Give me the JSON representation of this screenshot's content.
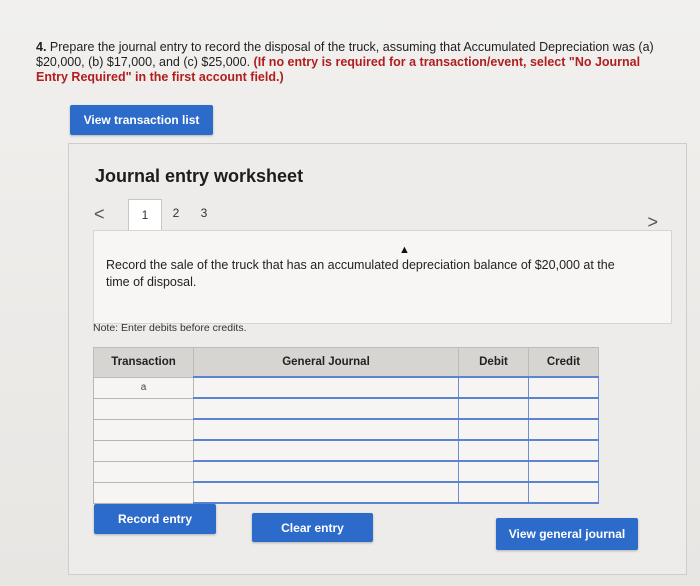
{
  "question": {
    "number": "4.",
    "text": "Prepare the journal entry to record the disposal of the truck, assuming that Accumulated Depreciation was (a) $20,000, (b) $17,000, and (c) $25,000.",
    "instruction": "(If no entry is required for a transaction/event, select \"No Journal Entry Required\" in the first account field.)"
  },
  "buttons": {
    "view_transaction_list": "View transaction list",
    "record_entry": "Record entry",
    "clear_entry": "Clear entry",
    "view_general_journal": "View general journal"
  },
  "worksheet": {
    "title": "Journal entry worksheet",
    "nav_prev": "<",
    "nav_next": ">",
    "tabs": [
      "1",
      "2",
      "3"
    ],
    "prompt": "Record the sale of the truck that has an accumulated depreciation balance of $20,000 at the time of disposal.",
    "note": "Note: Enter debits before credits."
  },
  "journal": {
    "headers": {
      "transaction": "Transaction",
      "general_journal": "General Journal",
      "debit": "Debit",
      "credit": "Credit"
    },
    "rows": [
      "a",
      "",
      "",
      "",
      "",
      ""
    ]
  }
}
